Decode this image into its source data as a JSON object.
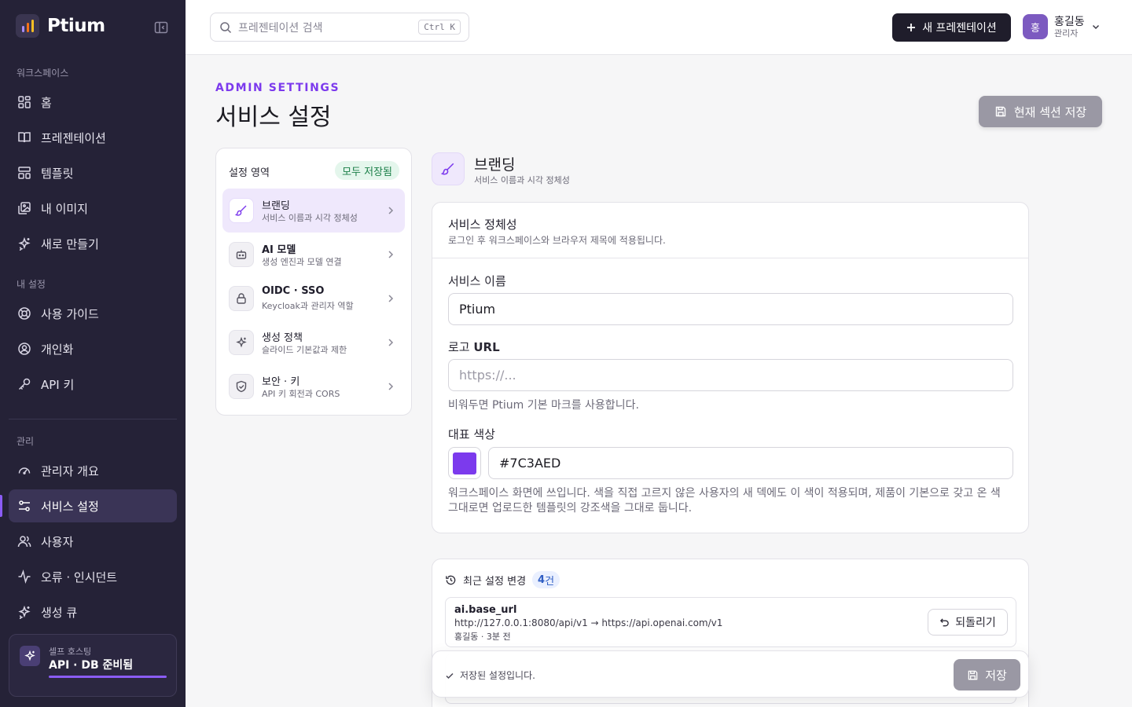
{
  "brand": {
    "name": "Ptium",
    "colors": {
      "accent": "#7C3AED",
      "sidebar": "#252237",
      "logo_bars": [
        "#a78bfa",
        "#f97316",
        "#fbbf24"
      ]
    }
  },
  "sidebar": {
    "collapse_icon": "sidebar-collapse-icon",
    "sections": {
      "workspace": "워크스페이스",
      "my_settings": "내 설정",
      "admin": "관리"
    },
    "workspace_items": [
      {
        "label": "홈",
        "icon": "grid-icon"
      },
      {
        "label": "프레젠테이션",
        "icon": "book-icon"
      },
      {
        "label": "템플릿",
        "icon": "template-icon"
      },
      {
        "label": "내 이미지",
        "icon": "images-icon"
      },
      {
        "label": "새로 만들기",
        "icon": "sparkle-icon"
      }
    ],
    "my_items": [
      {
        "label": "사용 가이드",
        "icon": "lifebuoy-icon"
      },
      {
        "label": "개인화",
        "icon": "user-circle-icon"
      },
      {
        "label": "API 키",
        "icon": "key-icon"
      }
    ],
    "admin_items": [
      {
        "label": "관리자 개요",
        "icon": "gauge-icon"
      },
      {
        "label": "서비스 설정",
        "icon": "sliders-icon",
        "active": true
      },
      {
        "label": "사용자",
        "icon": "users-icon"
      },
      {
        "label": "오류 · 인시던트",
        "icon": "activity-icon"
      },
      {
        "label": "생성 큐",
        "icon": "sparkle-icon"
      }
    ],
    "host": {
      "sub": "셀프 호스팅",
      "main": "API · DB 준비됨"
    }
  },
  "topbar": {
    "search": {
      "placeholder": "프레젠테이션 검색",
      "shortcut": "Ctrl K"
    },
    "new_button": "새 프레젠테이션",
    "user": {
      "initial": "홍",
      "name": "홍길동",
      "role": "관리자"
    }
  },
  "header": {
    "eyebrow": "ADMIN SETTINGS",
    "title": "서비스 설정",
    "save_section": "현재 섹션 저장"
  },
  "areas": {
    "title": "설정 영역",
    "status": "모두 저장됨",
    "items": [
      {
        "title": "브랜딩",
        "sub": "서비스 이름과 시각 정체성",
        "icon": "brush-icon",
        "active": true
      },
      {
        "title": "AI 모델",
        "sub": "생성 엔진과 모델 연결",
        "icon": "robot-icon"
      },
      {
        "title": "OIDC · SSO",
        "sub": "Keycloak과 관리자 역할",
        "icon": "lock-icon"
      },
      {
        "title": "생성 정책",
        "sub": "슬라이드 기본값과 제한",
        "icon": "sparkle-icon"
      },
      {
        "title": "보안 · 키",
        "sub": "API 키 회전과 CORS",
        "icon": "shield-icon"
      }
    ]
  },
  "section": {
    "title": "브랜딩",
    "sub": "서비스 이름과 시각 정체성",
    "card_title": "서비스 정체성",
    "card_desc": "로그인 후 워크스페이스와 브라우저 제목에 적용됩니다.",
    "service_name": {
      "label": "서비스 이름",
      "value": "Ptium"
    },
    "logo_url": {
      "label_prefix": "로고 ",
      "label_bold": "URL",
      "placeholder": "https://...",
      "hint": "비워두면 Ptium 기본 마크를 사용합니다."
    },
    "color": {
      "label": "대표 색상",
      "value": "#7C3AED",
      "hint": "워크스페이스 화면에 쓰입니다. 색을 직접 고르지 않은 사용자의 새 덱에도 이 색이 적용되며, 제품이 기본으로 갖고 온 색 그대로면 업로드한 템플릿의 강조색을 그대로 둡니다."
    }
  },
  "history": {
    "title": "최근 설정 변경",
    "count": "4",
    "count_unit": "건",
    "rows": [
      {
        "key": "ai.base_url",
        "change": "http://127.0.0.1:8080/api/v1 → https://api.openai.com/v1",
        "meta": "홍길동 · 3분 전",
        "revert": "되돌리기"
      }
    ]
  },
  "save_bar": {
    "status": "저장된 설정입니다.",
    "button": "저장"
  }
}
